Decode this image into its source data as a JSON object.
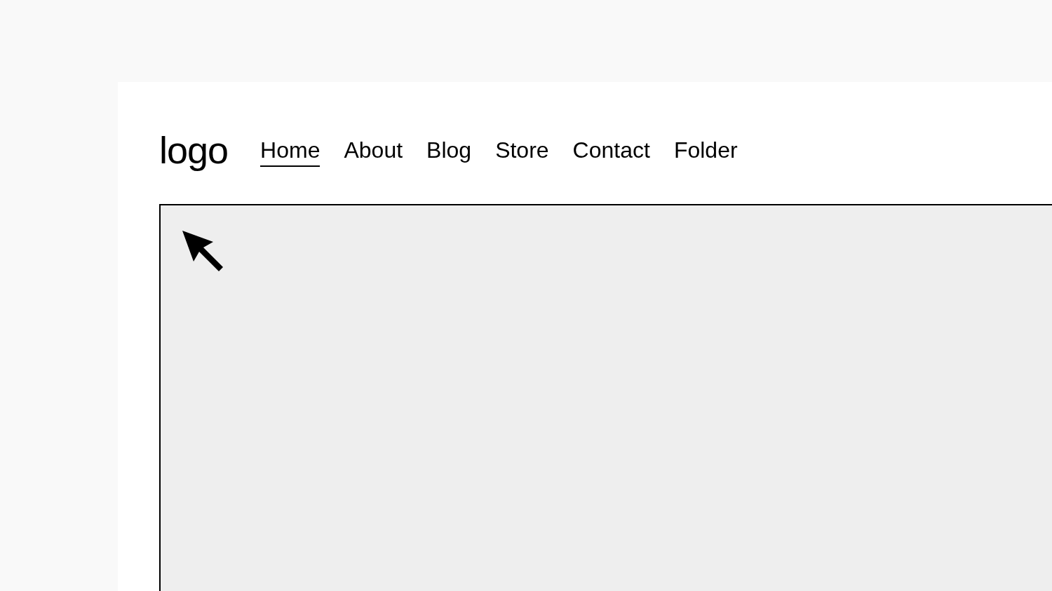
{
  "logo": "logo",
  "nav": [
    {
      "label": "Home",
      "selected": true
    },
    {
      "label": "About",
      "selected": false
    },
    {
      "label": "Blog",
      "selected": false
    },
    {
      "label": "Store",
      "selected": false
    },
    {
      "label": "Contact",
      "selected": false
    },
    {
      "label": "Folder",
      "selected": false
    }
  ]
}
